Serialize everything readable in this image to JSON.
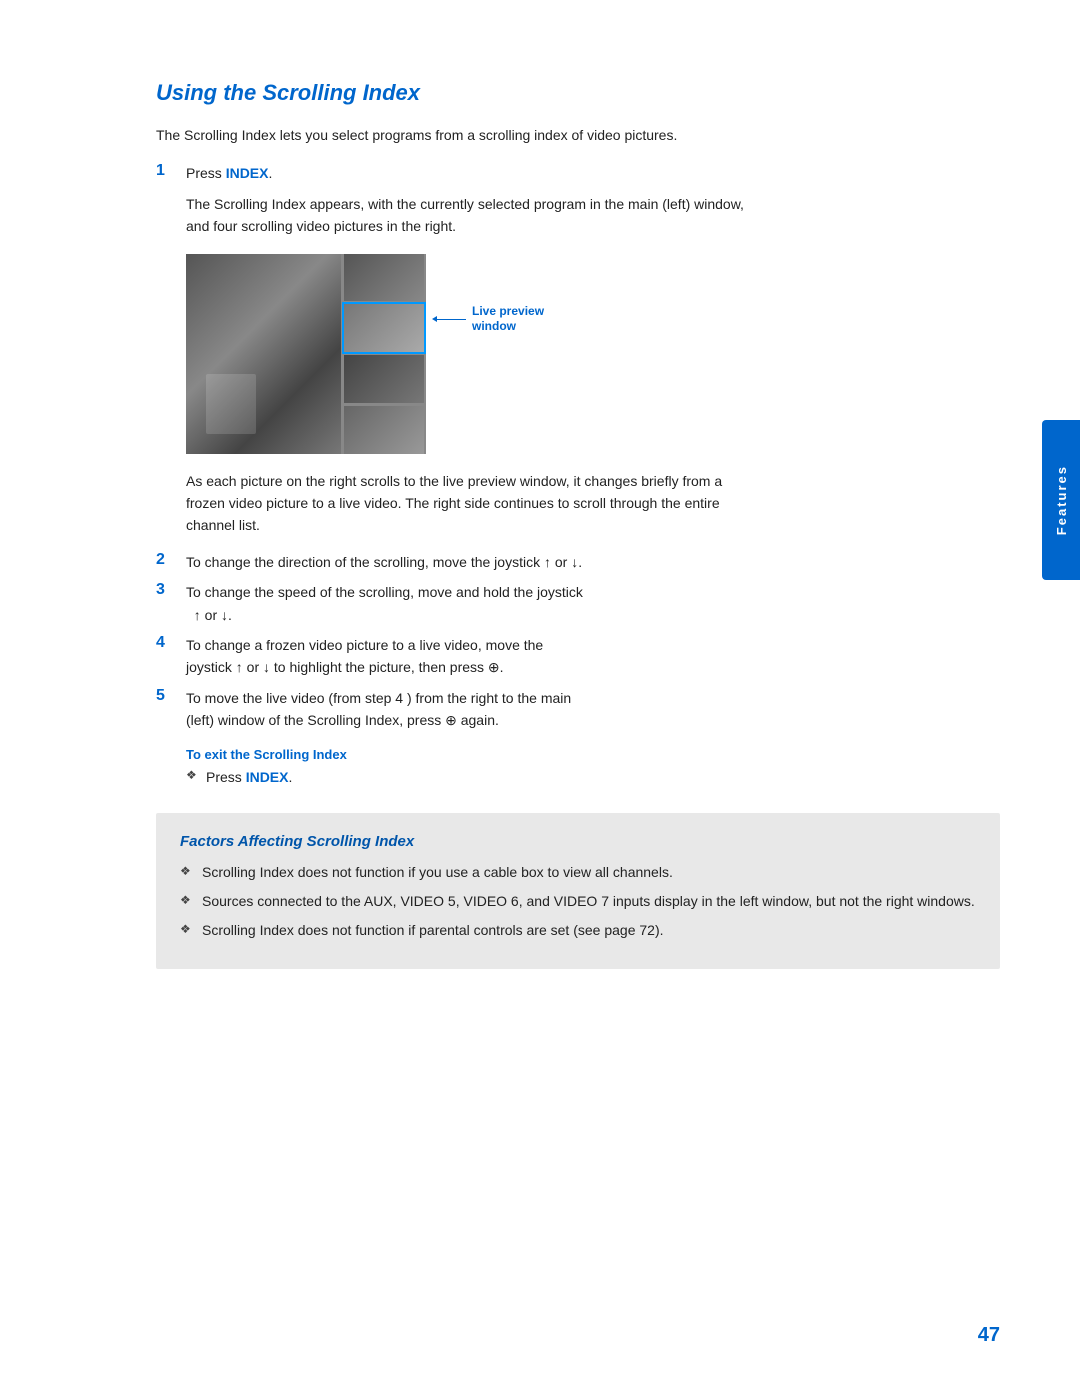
{
  "page": {
    "number": "47",
    "side_tab": "Features"
  },
  "section": {
    "title": "Using the Scrolling Index",
    "intro": "The Scrolling Index lets you select programs from a scrolling index of video pictures.",
    "step1_label": "1",
    "step1_text": "Press ",
    "step1_keyword": "INDEX",
    "step1_detail": "The Scrolling Index appears, with the currently selected program in the main (left) window, and four scrolling video pictures in the right.",
    "live_preview_label": "Live preview\nwindow",
    "after_image": "As each picture on the right scrolls to the live preview window, it changes briefly from a frozen video picture to a live video. The right side continues to scroll through the entire channel list.",
    "step2_label": "2",
    "step2_text": "To change the direction of the scrolling, move the joystick ↑ or ↓.",
    "step3_label": "3",
    "step3_text": "To change the speed of the scrolling, move and hold the joystick ↑ or ↓.",
    "step4_label": "4",
    "step4_text": "To change a frozen video picture to a live video, move the joystick ↑ or ↓ to highlight the picture, then press ⊕.",
    "step5_label": "5",
    "step5_text": "To move the live video (from step 4 ) from the right to the main (left) window of the Scrolling Index, press ⊕ again.",
    "exit_heading": "To exit the Scrolling Index",
    "exit_bullet": "Press ",
    "exit_keyword": "INDEX",
    "exit_period": "."
  },
  "factors": {
    "title": "Factors Affecting Scrolling Index",
    "bullets": [
      "Scrolling Index does not function if you use a cable box to view all channels.",
      "Sources connected to the AUX, VIDEO 5, VIDEO 6, and VIDEO 7 inputs display in the left window, but not the right windows.",
      "Scrolling Index does not function if parental controls are set (see page 72)."
    ]
  }
}
